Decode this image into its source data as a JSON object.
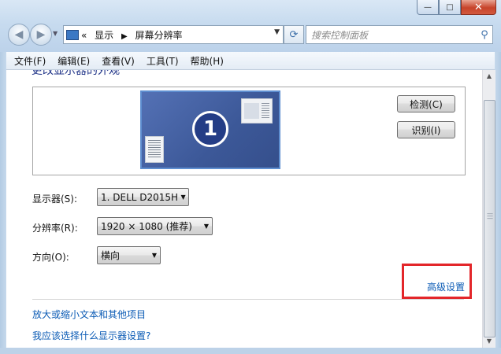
{
  "window": {
    "controls": {
      "minimize": "—",
      "maximize": "□",
      "close": "✕"
    }
  },
  "nav": {
    "back_icon": "◀",
    "forward_icon": "▶",
    "breadcrumb_overflow": "«",
    "breadcrumb": [
      "显示",
      "屏幕分辨率"
    ],
    "breadcrumb_sep": "▶",
    "dropdown_arrow": "▼",
    "refresh_icon": "⟳",
    "search_placeholder": "搜索控制面板",
    "search_icon": "⚲"
  },
  "menu": [
    "文件(F)",
    "编辑(E)",
    "查看(V)",
    "工具(T)",
    "帮助(H)"
  ],
  "page": {
    "heading_partial": "更改显示器的外观",
    "monitor_number": "1",
    "detect_button": "检测(C)",
    "identify_button": "识别(I)",
    "display_label": "显示器(S):",
    "display_value": "1. DELL D2015H",
    "resolution_label": "分辨率(R):",
    "resolution_value": "1920 × 1080 (推荐)",
    "orientation_label": "方向(O):",
    "orientation_value": "横向",
    "advanced_link": "高级设置",
    "links": [
      "放大或缩小文本和其他项目",
      "我应该选择什么显示器设置?"
    ]
  },
  "colors": {
    "link": "#0b5bb5",
    "highlight": "#e3262a",
    "monitor_blue": "#3c5898"
  }
}
